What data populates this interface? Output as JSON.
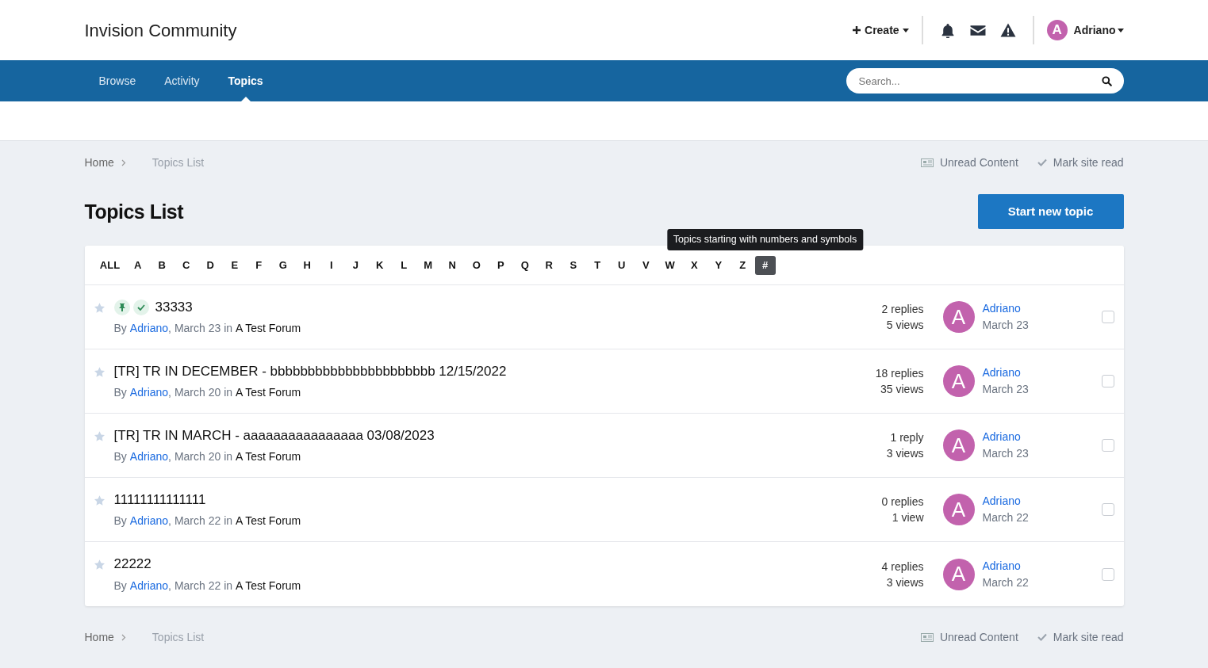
{
  "site_title": "Invision Community",
  "header": {
    "create_label": "Create",
    "user": {
      "initial": "A",
      "name": "Adriano"
    }
  },
  "nav": {
    "items": [
      {
        "label": "Browse",
        "selected": false
      },
      {
        "label": "Activity",
        "selected": false
      },
      {
        "label": "Topics",
        "selected": true
      }
    ],
    "search_placeholder": "Search..."
  },
  "breadcrumb": {
    "items": [
      "Home",
      "Topics List"
    ],
    "actions": [
      "Unread Content",
      "Mark site read"
    ]
  },
  "page_title": "Topics List",
  "start_button": "Start new topic",
  "letters": [
    {
      "label": "ALL",
      "selected": false
    },
    {
      "label": "A",
      "selected": false
    },
    {
      "label": "B",
      "selected": false
    },
    {
      "label": "C",
      "selected": false
    },
    {
      "label": "D",
      "selected": false
    },
    {
      "label": "E",
      "selected": false
    },
    {
      "label": "F",
      "selected": false
    },
    {
      "label": "G",
      "selected": false
    },
    {
      "label": "H",
      "selected": false
    },
    {
      "label": "I",
      "selected": false
    },
    {
      "label": "J",
      "selected": false
    },
    {
      "label": "K",
      "selected": false
    },
    {
      "label": "L",
      "selected": false
    },
    {
      "label": "M",
      "selected": false
    },
    {
      "label": "N",
      "selected": false
    },
    {
      "label": "O",
      "selected": false
    },
    {
      "label": "P",
      "selected": false
    },
    {
      "label": "Q",
      "selected": false
    },
    {
      "label": "R",
      "selected": false
    },
    {
      "label": "S",
      "selected": false
    },
    {
      "label": "T",
      "selected": false
    },
    {
      "label": "U",
      "selected": false
    },
    {
      "label": "V",
      "selected": false
    },
    {
      "label": "W",
      "selected": false
    },
    {
      "label": "X",
      "selected": false
    },
    {
      "label": "Y",
      "selected": false
    },
    {
      "label": "Z",
      "selected": false
    },
    {
      "label": "#",
      "selected": true
    }
  ],
  "tooltip": "Topics starting with numbers and symbols",
  "topics": [
    {
      "title": "33333",
      "pinned": true,
      "solved": true,
      "by": "By",
      "author": "Adriano",
      "date": ", March 23 in",
      "forum": "A Test Forum",
      "replies": "2 replies",
      "views": "5 views",
      "last_initial": "A",
      "last_user": "Adriano",
      "last_date": "March 23",
      "checked": false
    },
    {
      "title": "[TR] TR IN DECEMBER - bbbbbbbbbbbbbbbbbbbbbb 12/15/2022",
      "by": "By",
      "author": "Adriano",
      "date": ", March 20 in",
      "forum": "A Test Forum",
      "replies": "18 replies",
      "views": "35 views",
      "last_initial": "A",
      "last_user": "Adriano",
      "last_date": "March 23",
      "checked": false
    },
    {
      "title": "[TR] TR IN MARCH - aaaaaaaaaaaaaaaa 03/08/2023",
      "by": "By",
      "author": "Adriano",
      "date": ", March 20 in",
      "forum": "A Test Forum",
      "replies": "1 reply",
      "views": "3 views",
      "last_initial": "A",
      "last_user": "Adriano",
      "last_date": "March 23",
      "checked": false
    },
    {
      "title": "11111111111111",
      "by": "By",
      "author": "Adriano",
      "date": ", March 22 in",
      "forum": "A Test Forum",
      "replies": "0 replies",
      "views": "1 view",
      "last_initial": "A",
      "last_user": "Adriano",
      "last_date": "March 22",
      "checked": false
    },
    {
      "title": "22222",
      "by": "By",
      "author": "Adriano",
      "date": ", March 22 in",
      "forum": "A Test Forum",
      "replies": "4 replies",
      "views": "3 views",
      "last_initial": "A",
      "last_user": "Adriano",
      "last_date": "March 22",
      "checked": false
    }
  ],
  "footer_breadcrumb": {
    "items": [
      "Home",
      "Topics List"
    ],
    "actions": [
      "Unread Content",
      "Mark site read"
    ]
  }
}
